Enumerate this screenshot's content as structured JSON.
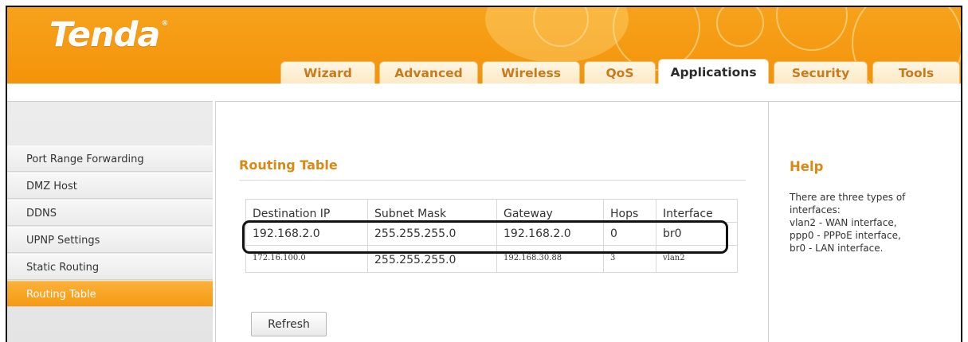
{
  "brand": {
    "logo": "Tenda",
    "reg_mark": "®"
  },
  "colors": {
    "brand_orange": "#f59a12",
    "title_orange": "#d98a14",
    "active_tab_text": "#2c2c2c"
  },
  "nav": {
    "tabs": [
      "Wizard",
      "Advanced",
      "Wireless",
      "QoS",
      "Applications",
      "Security",
      "Tools"
    ],
    "active_tab": "Applications"
  },
  "sidebar": {
    "items": [
      {
        "label": "Port Range Forwarding"
      },
      {
        "label": "DMZ Host"
      },
      {
        "label": "DDNS"
      },
      {
        "label": "UPNP Settings"
      },
      {
        "label": "Static Routing"
      },
      {
        "label": "Routing Table"
      }
    ],
    "active_item": "Routing Table"
  },
  "main": {
    "title": "Routing Table",
    "table": {
      "headers": [
        "Destination IP",
        "Subnet Mask",
        "Gateway",
        "Hops",
        "Interface"
      ],
      "rows": [
        [
          "192.168.2.0",
          "255.255.255.0",
          "192.168.2.0",
          "0",
          "br0"
        ],
        [
          "172.16.100.0",
          "255.255.255.0",
          "192.168.30.88",
          "3",
          "vlan2"
        ]
      ]
    },
    "refresh_label": "Refresh"
  },
  "help": {
    "title": "Help",
    "lines": [
      "There are three types of",
      "interfaces:",
      "vlan2 - WAN interface,",
      "ppp0 - PPPoE interface,",
      "br0 - LAN interface."
    ]
  }
}
